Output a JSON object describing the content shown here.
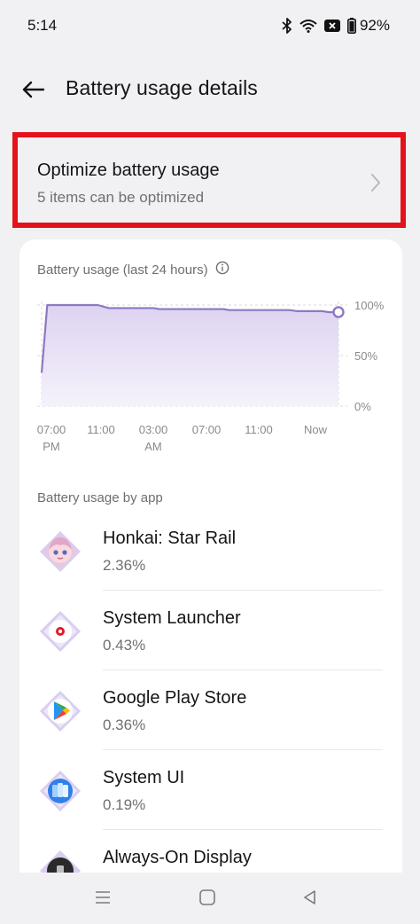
{
  "status_bar": {
    "time": "5:14",
    "battery_percent": "92%",
    "icons": [
      "bluetooth-icon",
      "wifi-icon",
      "dnd-icon",
      "battery-icon"
    ]
  },
  "header": {
    "title": "Battery usage details",
    "back_icon": "arrow-left-icon"
  },
  "optimize": {
    "title": "Optimize battery usage",
    "subtitle": "5 items can be optimized",
    "highlight_color": "#e5121b"
  },
  "chart": {
    "title": "Battery usage (last 24 hours)",
    "info_icon": "info-icon"
  },
  "chart_data": {
    "type": "area",
    "title": "Battery usage (last 24 hours)",
    "x_ticks": [
      "07:00\nPM",
      "11:00",
      "03:00\nAM",
      "07:00",
      "11:00",
      "Now"
    ],
    "y_ticks": [
      "100%",
      "50%",
      "0%"
    ],
    "ylim": [
      0,
      100
    ],
    "series": [
      {
        "values": [
          [
            0,
            33
          ],
          [
            0.4,
            100
          ],
          [
            4,
            100
          ],
          [
            4.8,
            97
          ],
          [
            8,
            97
          ],
          [
            8.4,
            96
          ],
          [
            13,
            96
          ],
          [
            13.4,
            95
          ],
          [
            17.7,
            95
          ],
          [
            18.2,
            94
          ],
          [
            20,
            94
          ],
          [
            20.5,
            93
          ],
          [
            21.2,
            93
          ]
        ]
      }
    ],
    "grid": true,
    "line_color": "#8c79c0",
    "fill_color": "#e9e3f5"
  },
  "apps_section_label": "Battery usage by app",
  "apps": [
    {
      "name": "Honkai: Star Rail",
      "percent": "2.36%",
      "icon": "honkai-star-rail-icon"
    },
    {
      "name": "System Launcher",
      "percent": "0.43%",
      "icon": "system-launcher-icon"
    },
    {
      "name": "Google Play Store",
      "percent": "0.36%",
      "icon": "google-play-store-icon"
    },
    {
      "name": "System UI",
      "percent": "0.19%",
      "icon": "system-ui-icon"
    },
    {
      "name": "Always-On Display",
      "percent": "",
      "icon": "always-on-display-icon"
    }
  ],
  "nav": {
    "icons": [
      "menu-icon",
      "home-icon",
      "back-icon"
    ]
  }
}
